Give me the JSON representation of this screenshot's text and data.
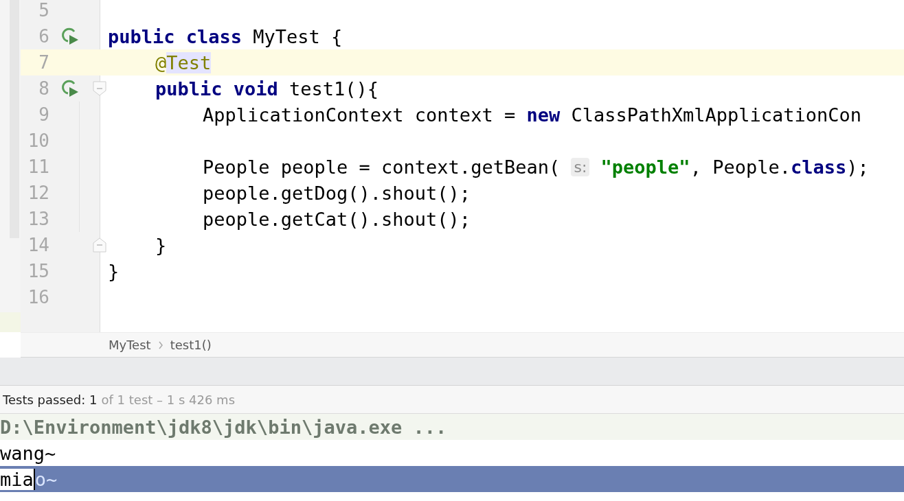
{
  "editor": {
    "lines": [
      {
        "number": "5",
        "current": false,
        "run": false,
        "fold_open": false,
        "fold_close": false
      },
      {
        "number": "6",
        "current": false,
        "run": true,
        "fold_open": false,
        "fold_close": false,
        "tokens": [
          {
            "kind": "keyword",
            "text": "public class"
          },
          {
            "kind": "plain",
            "text": " MyTest {"
          }
        ],
        "children": [
          {
            "number": "7",
            "current": true,
            "run": false,
            "fold_open": false,
            "fold_close": false,
            "tokens": [
              {
                "kind": "annotation",
                "text": "@"
              },
              {
                "kind": "annotation_ref",
                "text": "Test"
              }
            ]
          },
          {
            "number": "8",
            "current": false,
            "run": true,
            "fold_open": true,
            "fold_close": false,
            "tokens": [
              {
                "kind": "keyword",
                "text": "public void"
              },
              {
                "kind": "plain",
                "text": " test1(){"
              }
            ],
            "children": [
              {
                "number": "9",
                "current": false,
                "run": false,
                "fold_open": false,
                "fold_close": false,
                "tokens": [
                  {
                    "kind": "plain",
                    "text": "ApplicationContext context = "
                  },
                  {
                    "kind": "keyword",
                    "text": "new"
                  },
                  {
                    "kind": "plain",
                    "text": " ClassPathXmlApplicationCon"
                  }
                ]
              },
              {
                "number": "10",
                "current": false,
                "run": false,
                "fold_open": false,
                "fold_close": false
              },
              {
                "number": "11",
                "current": false,
                "run": false,
                "fold_open": false,
                "fold_close": false,
                "tokens": [
                  {
                    "kind": "plain",
                    "text": "People people = context.getBean( "
                  },
                  {
                    "kind": "hint",
                    "text": "s:"
                  },
                  {
                    "kind": "string",
                    "text": " \"people\""
                  },
                  {
                    "kind": "plain",
                    "text": ", People."
                  },
                  {
                    "kind": "keyword",
                    "text": "class"
                  },
                  {
                    "kind": "plain",
                    "text": ");"
                  }
                ]
              },
              {
                "number": "12",
                "current": false,
                "run": false,
                "fold_open": false,
                "fold_close": false,
                "tokens": [
                  {
                    "kind": "plain",
                    "text": "people.getDog().shout();"
                  }
                ]
              },
              {
                "number": "13",
                "current": false,
                "run": false,
                "fold_open": false,
                "fold_close": false,
                "tokens": [
                  {
                    "kind": "plain",
                    "text": "people.getCat().shout();"
                  }
                ]
              }
            ]
          },
          {
            "number": "14",
            "current": false,
            "run": false,
            "fold_open": false,
            "fold_close": true,
            "tokens": [
              {
                "kind": "plain",
                "text": "}"
              }
            ]
          }
        ]
      },
      {
        "number": "15",
        "current": false,
        "run": false,
        "fold_open": false,
        "fold_close": false,
        "tokens": [
          {
            "kind": "plain",
            "text": "}"
          }
        ]
      },
      {
        "number": "16",
        "current": false,
        "run": false,
        "fold_open": false,
        "fold_close": false
      }
    ]
  },
  "breadcrumbs": [
    "MyTest",
    "test1()"
  ],
  "test_status": {
    "summary": "Tests passed: 1",
    "detail": "of 1 test – 1 s 426 ms"
  },
  "console": {
    "lines": [
      {
        "kind": "command",
        "text": "D:\\Environment\\jdk8\\jdk\\bin\\java.exe ..."
      },
      {
        "kind": "output",
        "text": "wang~"
      },
      {
        "kind": "selection",
        "text": "mia",
        "selected_text": "o~"
      }
    ]
  }
}
